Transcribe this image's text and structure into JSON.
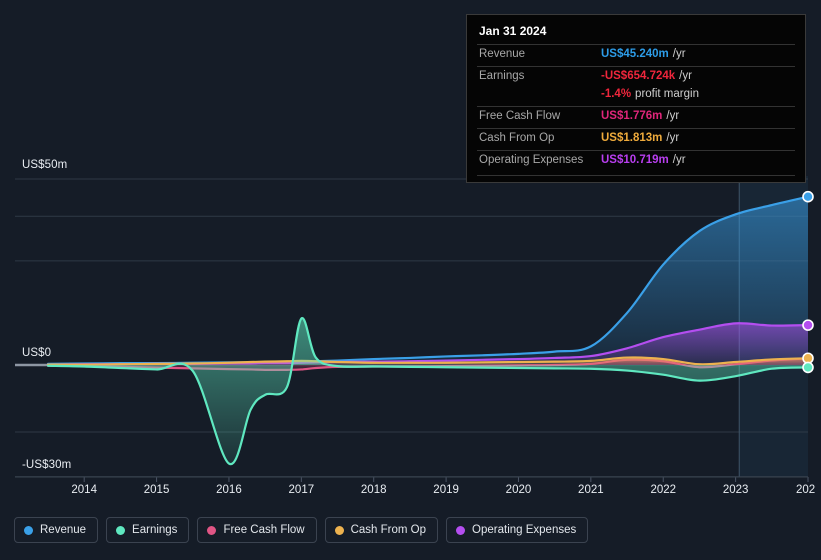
{
  "tooltip": {
    "date": "Jan 31 2024",
    "rows": [
      {
        "label": "Revenue",
        "value": "US$45.240m",
        "unit": "/yr",
        "color": "#2d9ce8"
      },
      {
        "label": "Earnings",
        "value": "-US$654.724k",
        "unit": "/yr",
        "color": "#f0263c"
      },
      {
        "label": "",
        "value": "-1.4%",
        "unit": "profit margin",
        "color": "#f0263c"
      },
      {
        "label": "Free Cash Flow",
        "value": "US$1.776m",
        "unit": "/yr",
        "color": "#e0267a"
      },
      {
        "label": "Cash From Op",
        "value": "US$1.813m",
        "unit": "/yr",
        "color": "#efab3c"
      },
      {
        "label": "Operating Expenses",
        "value": "US$10.719m",
        "unit": "/yr",
        "color": "#b93ef0"
      }
    ]
  },
  "legend": {
    "items": [
      {
        "label": "Revenue",
        "color": "#3aa0e8"
      },
      {
        "label": "Earnings",
        "color": "#5fe8c0"
      },
      {
        "label": "Free Cash Flow",
        "color": "#e05585"
      },
      {
        "label": "Cash From Op",
        "color": "#edb24f"
      },
      {
        "label": "Operating Expenses",
        "color": "#b44ef0"
      }
    ]
  },
  "axes": {
    "y_top_label": "US$50m",
    "y_zero_label": "US$0",
    "y_bottom_label": "-US$30m",
    "x_ticks": [
      "2014",
      "2015",
      "2016",
      "2017",
      "2018",
      "2019",
      "2020",
      "2021",
      "2022",
      "2023",
      "202"
    ]
  },
  "chart_data": {
    "type": "area",
    "title": "",
    "xlabel": "",
    "ylabel": "",
    "ylim": [
      -30,
      50
    ],
    "yticks": [
      50,
      0,
      -30
    ],
    "ytick_labels": [
      "US$50m",
      "US$0",
      "-US$30m"
    ],
    "grid": true,
    "legend_position": "bottom-left",
    "units": "US$ millions per year",
    "x": [
      2013.5,
      2014,
      2014.5,
      2015,
      2015.5,
      2016,
      2016.3,
      2016.5,
      2016.8,
      2017,
      2017.2,
      2017.5,
      2018,
      2018.5,
      2019,
      2019.5,
      2020,
      2020.5,
      2021,
      2021.5,
      2022,
      2022.5,
      2023,
      2023.5,
      2024
    ],
    "forecast_boundary_x": 2023.05,
    "series": [
      {
        "name": "Revenue",
        "color": "#3aa0e8",
        "values": [
          0.3,
          0.4,
          0.5,
          0.5,
          0.6,
          0.7,
          0.7,
          0.7,
          0.8,
          0.9,
          1.0,
          1.2,
          1.6,
          1.9,
          2.3,
          2.6,
          3.0,
          3.6,
          5.0,
          14.0,
          27.0,
          36.0,
          40.5,
          43.0,
          45.24
        ],
        "end_value": 45.24,
        "end_label": "US$45.240m"
      },
      {
        "name": "Earnings",
        "color": "#5fe8c0",
        "values": [
          -0.2,
          -0.4,
          -0.8,
          -1.2,
          -1.6,
          -26.5,
          -12.0,
          -8.0,
          -6.0,
          12.5,
          2.0,
          -0.3,
          -0.4,
          -0.5,
          -0.6,
          -0.7,
          -0.8,
          -0.9,
          -1.0,
          -1.5,
          -2.6,
          -4.2,
          -3.0,
          -1.0,
          -0.65
        ],
        "end_value": -0.654724,
        "end_label": "-US$654.724k"
      },
      {
        "name": "Free Cash Flow",
        "color": "#e05585",
        "values": [
          -0.2,
          -0.3,
          -0.5,
          -0.7,
          -0.9,
          -1.1,
          -1.2,
          -1.3,
          -1.3,
          -1.2,
          -0.8,
          -0.5,
          -0.4,
          -0.4,
          -0.3,
          -0.2,
          -0.1,
          0.0,
          0.3,
          1.4,
          1.0,
          -0.6,
          0.2,
          1.2,
          1.776
        ],
        "end_value": 1.776,
        "end_label": "US$1.776m"
      },
      {
        "name": "Cash From Op",
        "color": "#edb24f",
        "values": [
          0.1,
          0.1,
          0.2,
          0.3,
          0.4,
          0.6,
          0.8,
          0.9,
          1.0,
          1.1,
          1.0,
          0.8,
          0.6,
          0.6,
          0.6,
          0.7,
          0.8,
          0.9,
          1.1,
          2.0,
          1.6,
          0.2,
          0.8,
          1.5,
          1.813
        ]
      },
      {
        "name": "Operating Expenses",
        "color": "#b44ef0",
        "values": [
          0.1,
          0.2,
          0.2,
          0.3,
          0.3,
          0.4,
          0.4,
          0.5,
          0.5,
          0.6,
          0.7,
          0.8,
          0.9,
          1.0,
          1.2,
          1.4,
          1.6,
          1.9,
          2.4,
          4.5,
          7.5,
          9.5,
          11.2,
          10.6,
          10.719
        ],
        "end_value": 10.719,
        "end_label": "US$10.719m"
      }
    ]
  }
}
